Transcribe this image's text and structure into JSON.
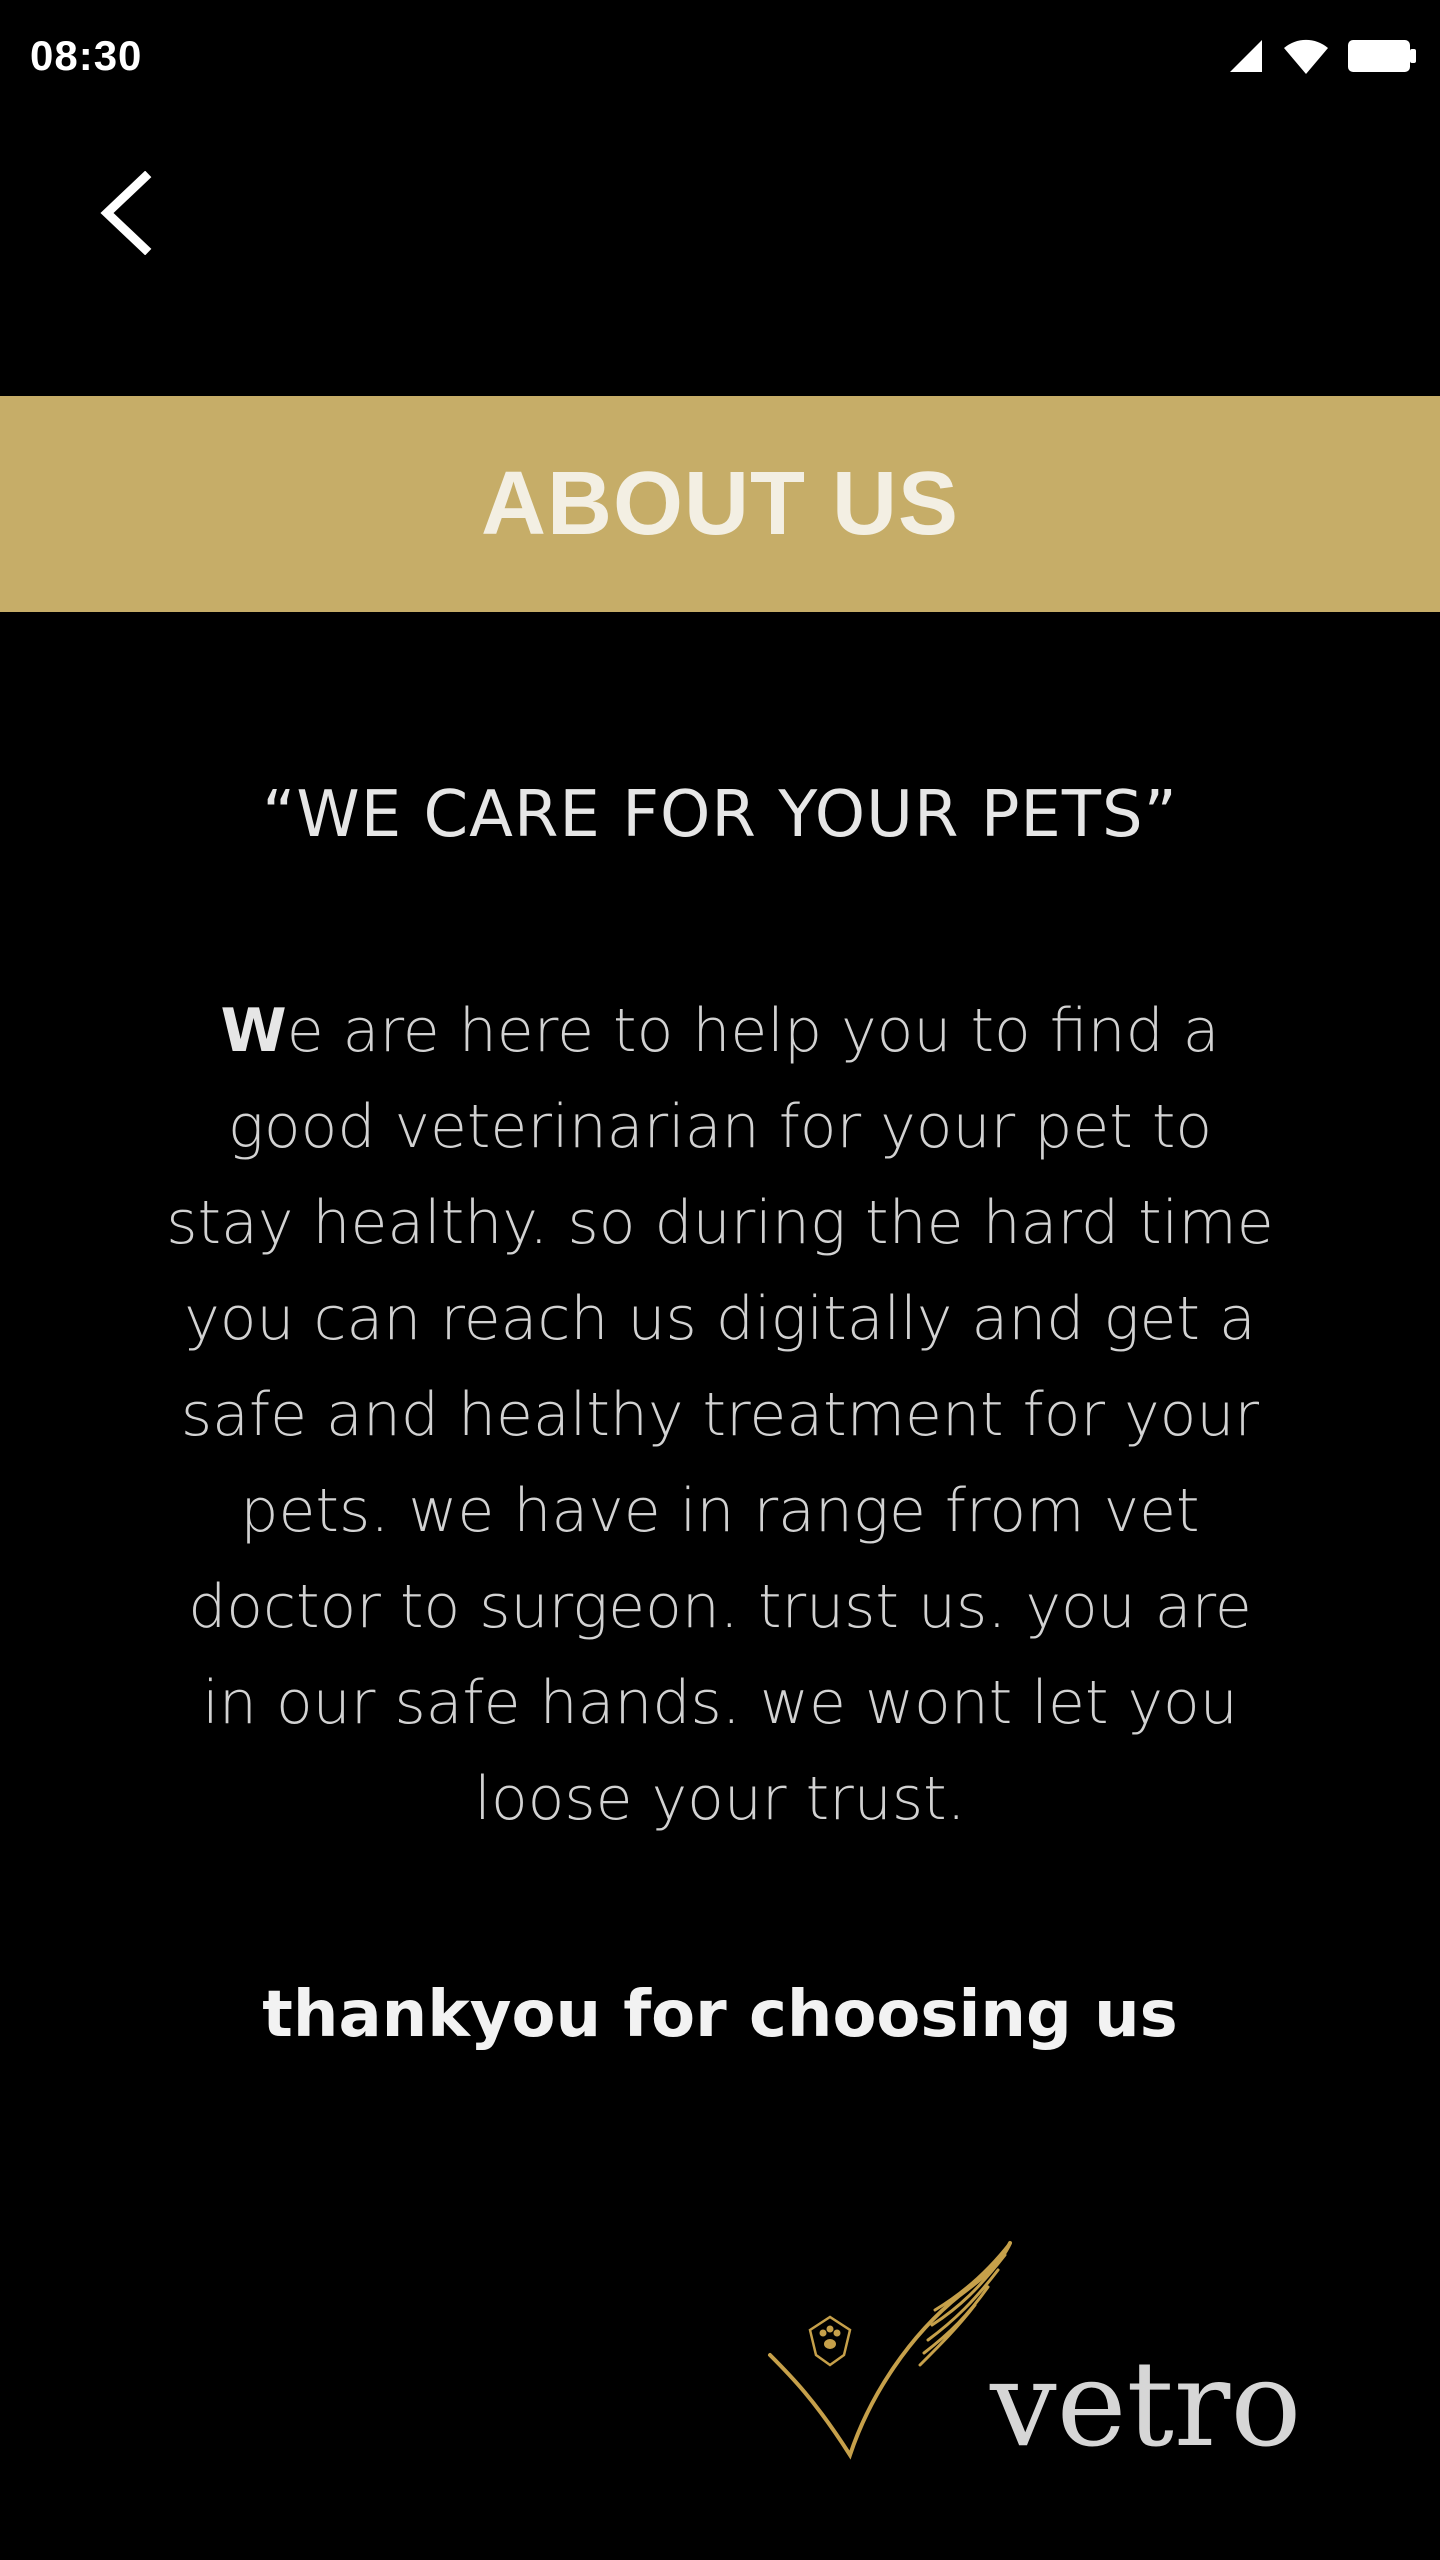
{
  "status_bar": {
    "time": "08:30",
    "icons": [
      "signal-icon",
      "wifi-icon",
      "battery-icon"
    ]
  },
  "nav": {
    "back_icon": "chevron-left-icon"
  },
  "banner": {
    "title": "ABOUT US",
    "color": "#c6ad68"
  },
  "content": {
    "tagline": "“WE CARE FOR YOUR PETS”",
    "body_first_letter": "W",
    "body_rest": "e are here to help you to find a good veterinarian for your pet to stay healthy. so during the hard time you can reach us digitally and get a safe and healthy treatment for your pets. we have in range from vet doctor to surgeon. trust us. you are in our safe hands. we wont let you loose your trust.",
    "thanks": "thankyou for choosing us"
  },
  "logo": {
    "text": "vetro",
    "accent_color": "#c6a04a"
  },
  "colors": {
    "background": "#000000",
    "gold": "#c6ad68"
  }
}
